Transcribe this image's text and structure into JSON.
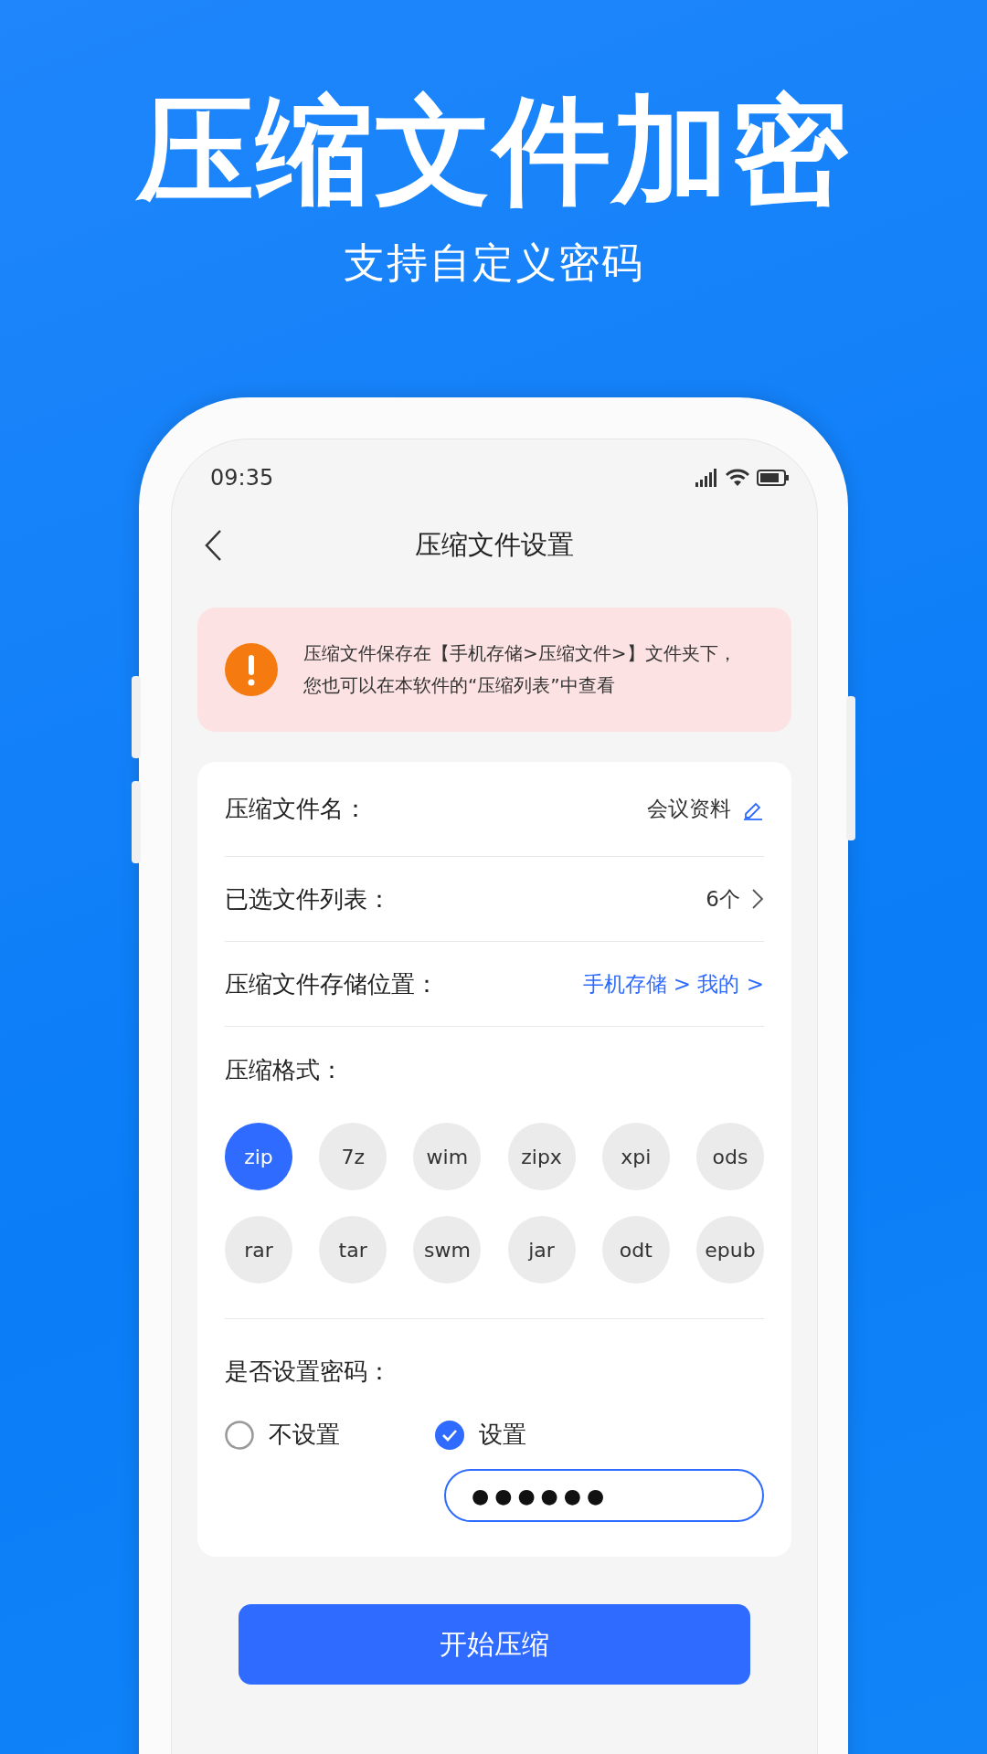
{
  "headline": "压缩文件加密",
  "subheadline": "支持自定义密码",
  "status_bar": {
    "time": "09:35"
  },
  "nav": {
    "title": "压缩文件设置"
  },
  "notice": {
    "lines": [
      "压缩文件保存在【手机存储>压缩文件>】文件夹下，",
      "您也可以在本软件的“压缩列表”中查看"
    ]
  },
  "rows": [
    {
      "label": "压缩文件名：",
      "value": "会议资料",
      "kind": "edit"
    },
    {
      "label": "已选文件列表：",
      "value": "6个",
      "kind": "chevron"
    },
    {
      "label": "压缩文件存储位置：",
      "value": "手机存储 > 我的 >",
      "kind": "link"
    }
  ],
  "format": {
    "label": "压缩格式：",
    "options": [
      {
        "label": "zip",
        "selected": true
      },
      {
        "label": "7z",
        "selected": false
      },
      {
        "label": "wim",
        "selected": false
      },
      {
        "label": "zipx",
        "selected": false
      },
      {
        "label": "xpi",
        "selected": false
      },
      {
        "label": "ods",
        "selected": false
      },
      {
        "label": "rar",
        "selected": false
      },
      {
        "label": "tar",
        "selected": false
      },
      {
        "label": "swm",
        "selected": false
      },
      {
        "label": "jar",
        "selected": false
      },
      {
        "label": "odt",
        "selected": false
      },
      {
        "label": "epub",
        "selected": false
      }
    ]
  },
  "password": {
    "label": "是否设置密码：",
    "options": [
      {
        "label": "不设置",
        "selected": false
      },
      {
        "label": "设置",
        "selected": true
      }
    ],
    "value": "●●●●●●"
  },
  "button": "开始压缩"
}
